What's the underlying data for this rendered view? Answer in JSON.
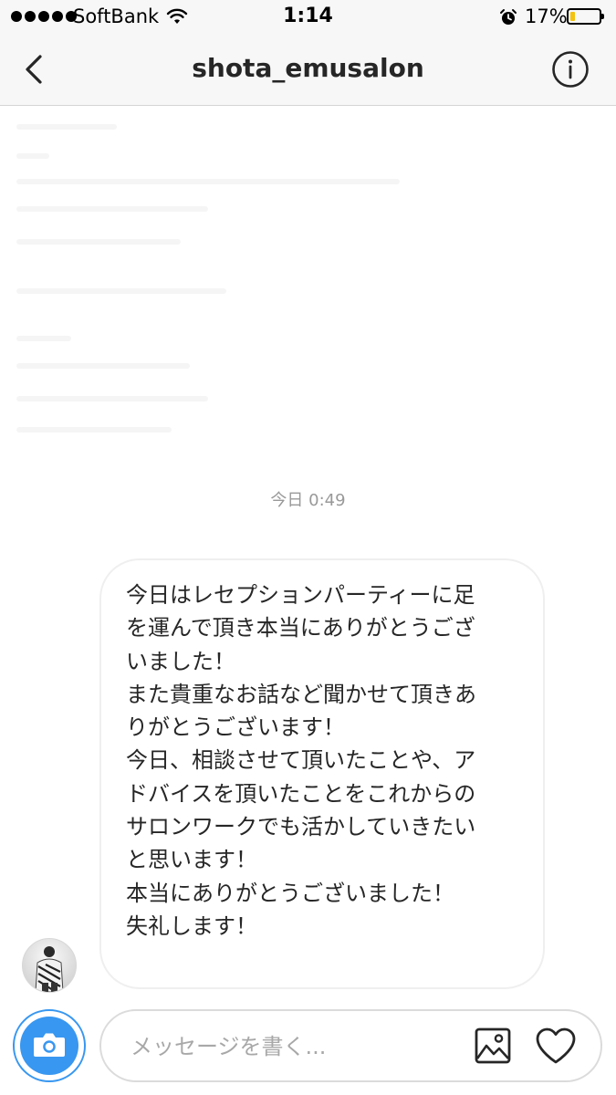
{
  "status_bar": {
    "carrier": "SoftBank",
    "time": "1:14",
    "battery_percent": "17%",
    "battery_level": 0.17,
    "icons": [
      "signal-dots-icon",
      "wifi-icon",
      "alarm-icon",
      "battery-icon"
    ]
  },
  "nav": {
    "title": "shota_emusalon",
    "back_icon": "chevron-left-icon",
    "info_icon": "info-circle-icon"
  },
  "conversation": {
    "timestamp": "今日 0:49",
    "message": {
      "lines": [
        "今日はレセプションパーティーに足",
        "を運んで頂き本当にありがとうござ",
        "いました！",
        "また貴重なお話など聞かせて頂きあ",
        "りがとうございます！",
        "今日、相談させて頂いたことや、ア",
        "ドバイスを頂いたことをこれからの",
        "サロンワークでも活かしていきたい",
        "と思います！",
        "本当にありがとうございました！",
        "失礼します！"
      ]
    }
  },
  "composer": {
    "placeholder": "メッセージを書く...",
    "value": "",
    "camera_icon": "camera-icon",
    "gallery_icon": "image-gallery-icon",
    "like_icon": "heart-icon"
  },
  "colors": {
    "accent": "#3897f0",
    "battery_low": "#f4c20d",
    "bubble_border": "#efefef",
    "timestamp": "#999999"
  }
}
